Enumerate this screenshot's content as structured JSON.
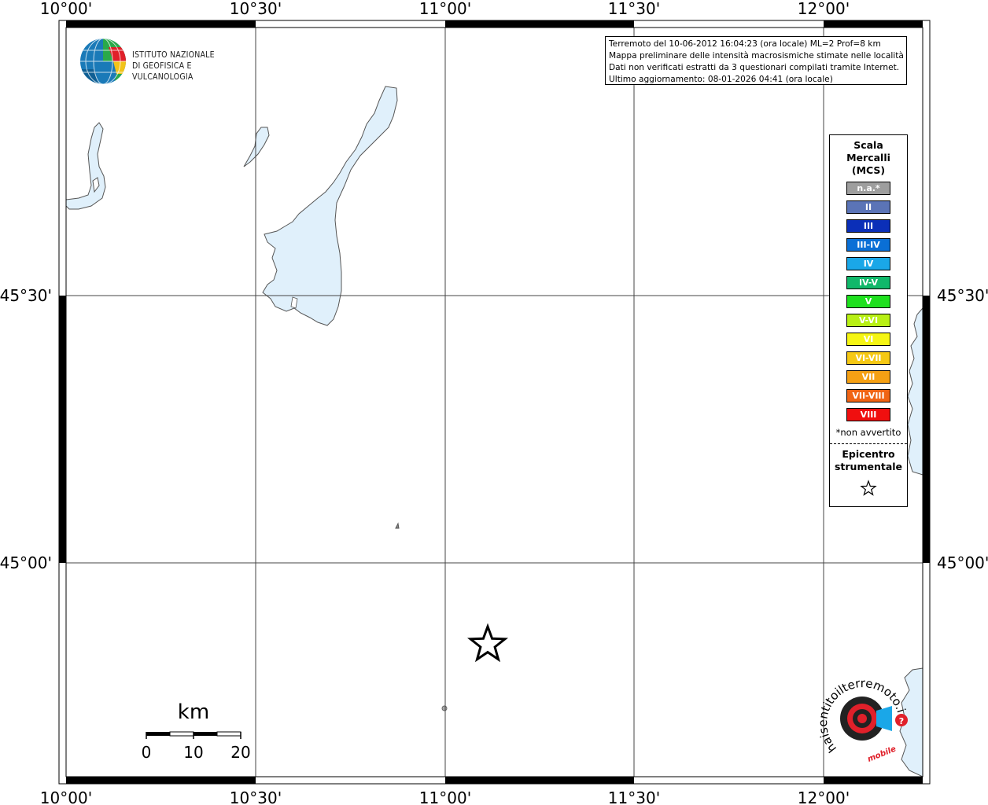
{
  "map": {
    "top_ticks": [
      "10°00'",
      "10°30'",
      "11°00'",
      "11°30'",
      "12°00'"
    ],
    "bottom_ticks": [
      "10°00'",
      "10°30'",
      "11°00'",
      "11°30'",
      "12°00'"
    ],
    "left_ticks": [
      "45°30'",
      "45°00'"
    ],
    "right_ticks": [
      "45°30'",
      "45°00'"
    ],
    "colors": {
      "water": "#e0f0fb",
      "coast": "#555555",
      "grid": "#444444"
    }
  },
  "logo": {
    "line1": "ISTITUTO NAZIONALE",
    "line2": "DI GEOFISICA E VULCANOLOGIA"
  },
  "info": {
    "line1": "Terremoto del 10-06-2012 16:04:23 (ora locale) ML=2 Prof=8 km",
    "line2": "Mappa preliminare delle intensità macrosismiche stimate nelle località",
    "line3": "Dati non verificati estratti da 3 questionari compilati tramite Internet.",
    "line4": "Ultimo aggiornamento: 08-01-2026 04:41 (ora locale)"
  },
  "legend": {
    "title_line1": "Scala",
    "title_line2": "Mercalli",
    "title_line3": "(MCS)",
    "items": [
      {
        "label": "n.a.*",
        "color": "#9e9e9e"
      },
      {
        "label": "II",
        "color": "#5b74b7"
      },
      {
        "label": "III",
        "color": "#0b2fb8"
      },
      {
        "label": "III-IV",
        "color": "#0a6fd6"
      },
      {
        "label": "IV",
        "color": "#1aa7e8"
      },
      {
        "label": "IV-V",
        "color": "#10b86a"
      },
      {
        "label": "V",
        "color": "#1ee01e"
      },
      {
        "label": "V-VI",
        "color": "#b8f014"
      },
      {
        "label": "VI",
        "color": "#f5f514"
      },
      {
        "label": "VI-VII",
        "color": "#f5c814"
      },
      {
        "label": "VII",
        "color": "#f5a014"
      },
      {
        "label": "VII-VIII",
        "color": "#f06414"
      },
      {
        "label": "VIII",
        "color": "#f00f0f"
      }
    ],
    "note": "*non avvertito",
    "epi_line1": "Epicentro",
    "epi_line2": "strumentale"
  },
  "scalebar": {
    "unit": "km",
    "ticks": [
      "0",
      "10",
      "20"
    ]
  },
  "sentito": {
    "text": "haisentitoilterremoto.it",
    "mobile": "mobile"
  }
}
